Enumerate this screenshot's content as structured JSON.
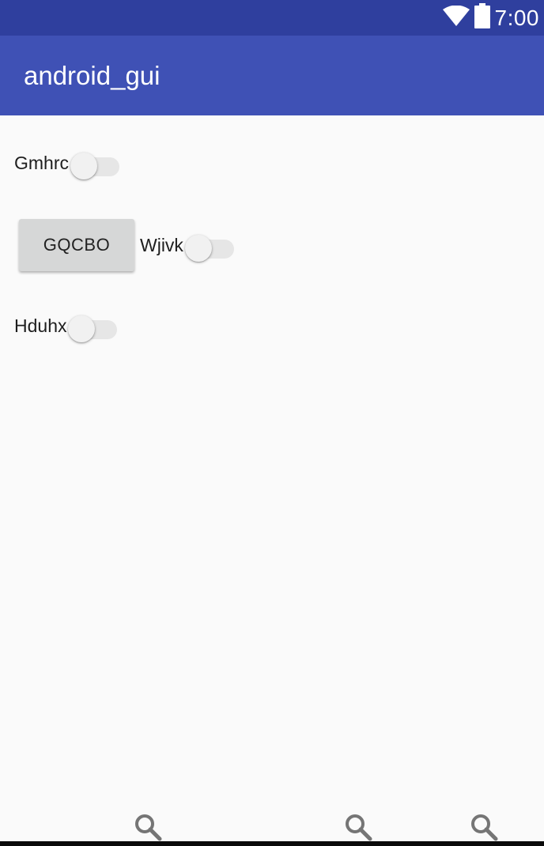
{
  "status_bar": {
    "time": "7:00",
    "icons": [
      "wifi-icon",
      "battery-icon"
    ]
  },
  "app_bar": {
    "title": "android_gui"
  },
  "content": {
    "switch_gmhrc": {
      "label": "Gmhrc",
      "checked": false
    },
    "button_gqcbo": {
      "label": "GQCBO"
    },
    "switch_wjivk": {
      "label": "Wjivk",
      "checked": false
    },
    "switch_hduhx": {
      "label": "Hduhx",
      "checked": false
    }
  },
  "bottom_bar": {
    "icons": [
      "search-icon",
      "search-icon",
      "search-icon"
    ]
  },
  "colors": {
    "status_bar": "#2f3f9e",
    "app_bar": "#3f51b5",
    "background": "#fafafa",
    "button": "#d6d7d7"
  }
}
